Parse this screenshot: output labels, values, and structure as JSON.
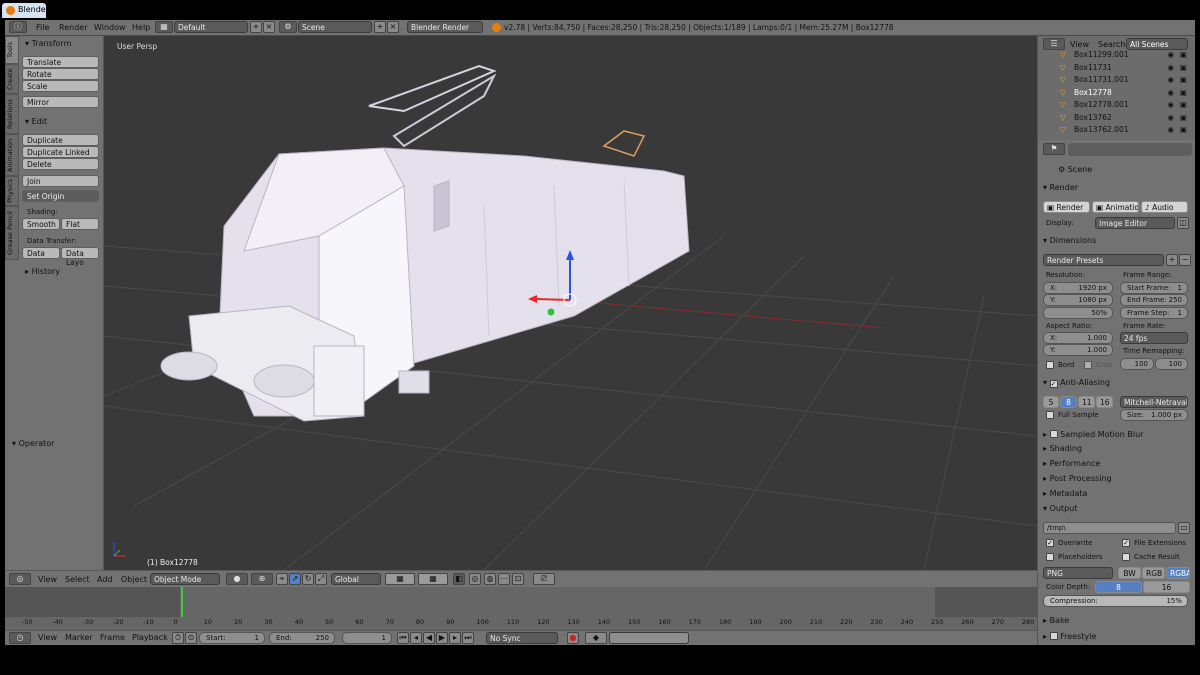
{
  "window": {
    "title": "Blender"
  },
  "topbar": {
    "menus": [
      "File",
      "Render",
      "Window",
      "Help"
    ],
    "layout": "Default",
    "scene": "Scene",
    "engine": "Blender Render",
    "stats": "v2.78 | Verts:84,750 | Faces:28,250 | Tris:28,250 | Objects:1/189 | Lamps:0/1 | Mem:25.27M | Box12778"
  },
  "toolshelf": {
    "tabs": [
      "Tools",
      "Create",
      "Relations",
      "Animation",
      "Physics",
      "Grease Pencil"
    ],
    "transform_header": "Transform",
    "transform": [
      "Translate",
      "Rotate",
      "Scale"
    ],
    "mirror": "Mirror",
    "edit_header": "Edit",
    "edit": [
      "Duplicate",
      "Duplicate Linked",
      "Delete"
    ],
    "join": "Join",
    "set_origin": "Set Origin",
    "shading_label": "Shading:",
    "smooth": "Smooth",
    "flat": "Flat",
    "data_transfer_label": "Data Transfer:",
    "data": "Data",
    "data_layout": "Data Layo",
    "history": "History",
    "operator": "Operator"
  },
  "viewport": {
    "view_label": "User Persp",
    "object_label": "(1) Box12778"
  },
  "viewheader": {
    "menus": [
      "View",
      "Select",
      "Add",
      "Object"
    ],
    "mode": "Object Mode",
    "orientation": "Global"
  },
  "timeline": {
    "ticks": [
      "-50",
      "-40",
      "-30",
      "-20",
      "-10",
      "0",
      "10",
      "20",
      "30",
      "40",
      "50",
      "60",
      "70",
      "80",
      "90",
      "100",
      "110",
      "120",
      "130",
      "140",
      "150",
      "160",
      "170",
      "180",
      "190",
      "200",
      "210",
      "220",
      "230",
      "240",
      "250",
      "260",
      "270",
      "280"
    ],
    "menus": [
      "View",
      "Marker",
      "Frame",
      "Playback"
    ],
    "start_label": "Start:",
    "start": "1",
    "end_label": "End:",
    "end": "250",
    "current": "1",
    "sync": "No Sync"
  },
  "outliner": {
    "tabs": [
      "View",
      "Search",
      "All Scenes"
    ],
    "rows": [
      "Box11299.001",
      "Box11731",
      "Box11731.001",
      "Box12778",
      "Box12778.001",
      "Box13762",
      "Box13762.001"
    ],
    "selected": "Box12778"
  },
  "properties": {
    "context": "Scene",
    "render_header": "Render",
    "render_btn": "Render",
    "animation_btn": "Animation",
    "audio_btn": "Audio",
    "display_label": "Display:",
    "display": "Image Editor",
    "dimensions_header": "Dimensions",
    "presets": "Render Presets",
    "resolution_label": "Resolution:",
    "res_x_label": "X:",
    "res_x": "1920 px",
    "res_y_label": "Y:",
    "res_y": "1080 px",
    "res_pct": "50%",
    "frame_range_label": "Frame Range:",
    "start_frame_label": "Start Frame:",
    "start_frame": "1",
    "end_frame_label": "End Frame:",
    "end_frame": "250",
    "frame_step_label": "Frame Step:",
    "frame_step": "1",
    "aspect_label": "Aspect Ratio:",
    "asp_x_label": "X:",
    "asp_x": "1.000",
    "asp_y_label": "Y:",
    "asp_y": "1.000",
    "frame_rate_label": "Frame Rate:",
    "fps": "24 fps",
    "time_remap_label": "Time Remapping:",
    "remap_old": "100",
    "remap_new": "100",
    "bord": "Bord",
    "crop": "Crop",
    "aa_header": "Anti-Aliasing",
    "aa_samples": [
      "5",
      "8",
      "11",
      "16"
    ],
    "aa_active": "8",
    "filter": "Mitchell-Netravali",
    "full_sample": "Full Sample",
    "size_label": "Size:",
    "size": "1.000 px",
    "collapsed": [
      "Sampled Motion Blur",
      "Shading",
      "Performance",
      "Post Processing",
      "Metadata"
    ],
    "output_header": "Output",
    "path": "/tmp\\",
    "overwrite": "Overwrite",
    "file_ext": "File Extensions",
    "placeholders": "Placeholders",
    "cache": "Cache Result",
    "format": "PNG",
    "color_modes": [
      "BW",
      "RGB",
      "RGBA"
    ],
    "color_active": "RGBA",
    "depth_label": "Color Depth:",
    "depth_8": "8",
    "depth_16": "16",
    "compression_label": "Compression:",
    "compression": "15%",
    "bake": "Bake",
    "freestyle": "Freestyle"
  },
  "colors": {
    "accent": "#5680c2",
    "viewport": "#393939",
    "panel": "#727272",
    "model": "#e4e0ec"
  }
}
